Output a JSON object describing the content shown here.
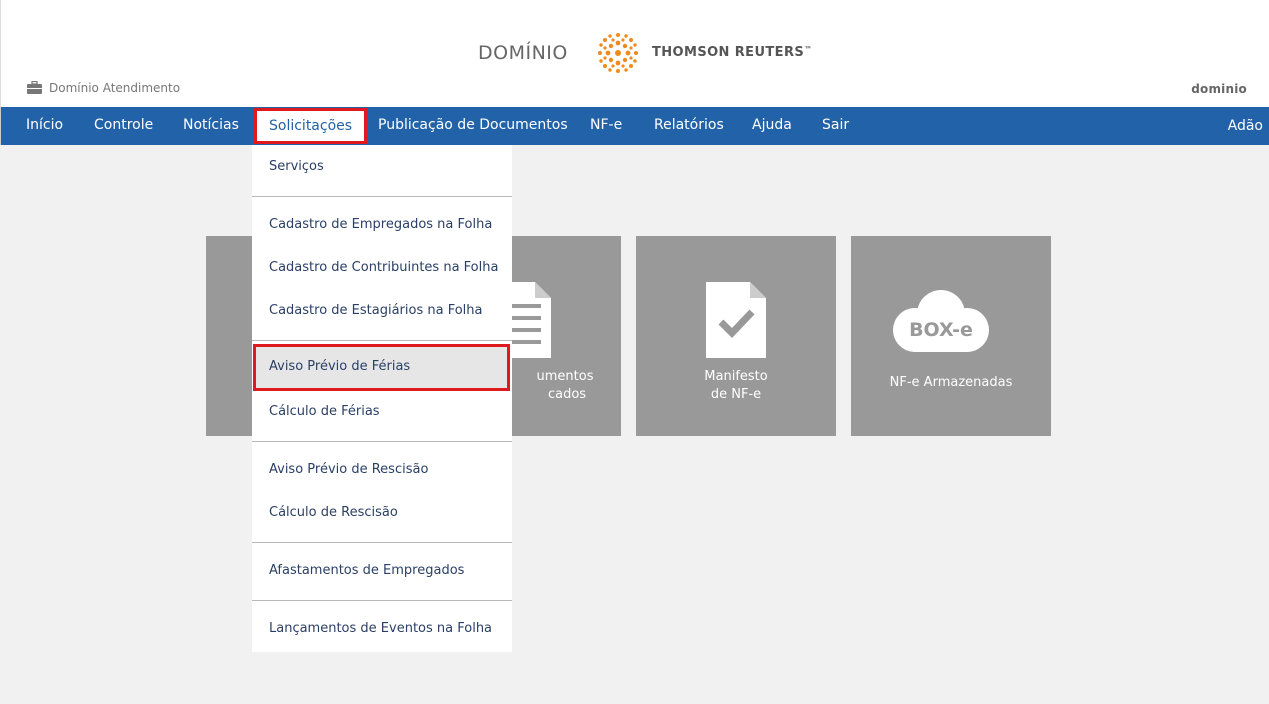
{
  "header": {
    "brand": "DOMÍNIO",
    "partner": "THOMSON REUTERS",
    "partner_tm": "™",
    "service": "Domínio Atendimento",
    "small_logo": "dominio"
  },
  "nav": {
    "items": [
      "Início",
      "Controle",
      "Notícias",
      "Solicitações",
      "Publicação de Documentos",
      "NF-e",
      "Relatórios",
      "Ajuda",
      "Sair"
    ],
    "active": "Solicitações",
    "user": "Adão"
  },
  "tiles": [
    {
      "label_1": "",
      "label_2": "",
      "icon": "blank"
    },
    {
      "label_1": "umentos",
      "label_2": "cados",
      "icon": "document-list-icon"
    },
    {
      "label_1": "Manifesto",
      "label_2": "de NF-e",
      "icon": "document-check-icon"
    },
    {
      "label_1": "NF-e Armazenadas",
      "label_2": "",
      "icon": "box-e-cloud-icon",
      "icon_text": "BOX-e"
    }
  ],
  "dropdown": {
    "items": [
      "Serviços",
      "Cadastro de Empregados na Folha",
      "Cadastro de Contribuintes na Folha",
      "Cadastro de Estagiários na Folha",
      "Aviso Prévio de Férias",
      "Cálculo de Férias",
      "Aviso Prévio de Rescisão",
      "Cálculo de Rescisão",
      "Afastamentos de Empregados",
      "Lançamentos de Eventos na Folha"
    ],
    "selected": "Aviso Prévio de Férias"
  },
  "colors": {
    "nav_bg": "#2262a8",
    "tile_bg": "#999999",
    "highlight": "#e0191d",
    "page_bg": "#f1f1f1"
  }
}
